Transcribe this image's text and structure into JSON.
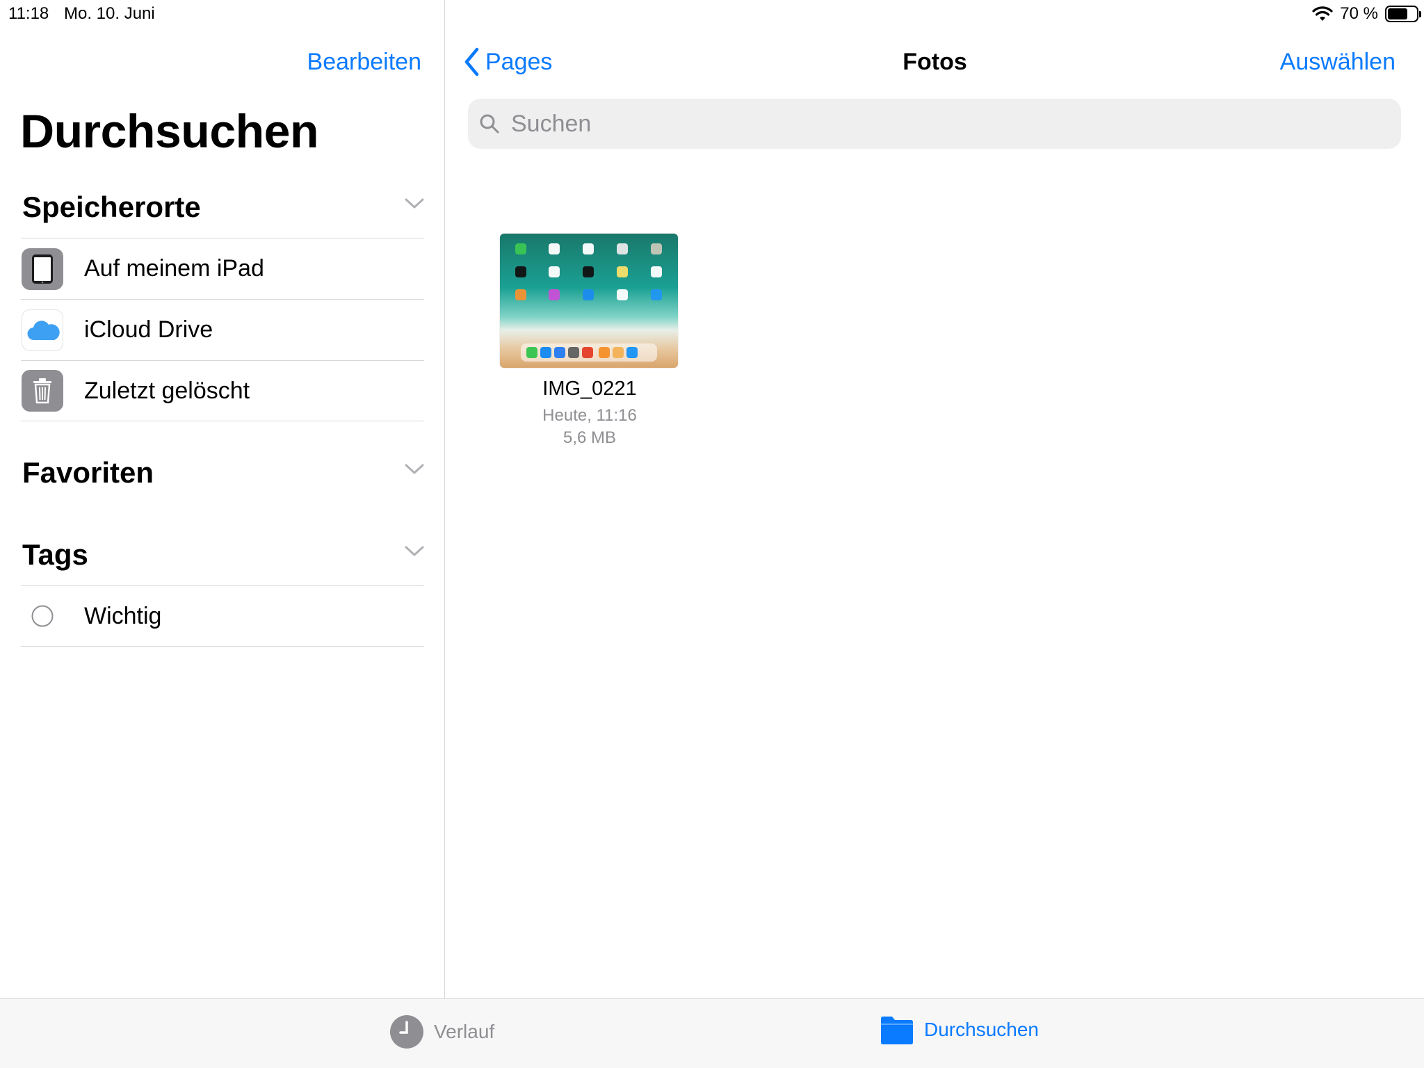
{
  "status_bar": {
    "time": "11:18",
    "date": "Mo. 10. Juni",
    "battery_percent": "70 %",
    "battery_level": 0.7
  },
  "sidebar": {
    "edit_label": "Bearbeiten",
    "title": "Durchsuchen",
    "locations": {
      "title": "Speicherorte",
      "items": [
        {
          "label": "Auf meinem iPad",
          "icon": "ipad-icon"
        },
        {
          "label": "iCloud Drive",
          "icon": "icloud-icon"
        },
        {
          "label": "Zuletzt gelöscht",
          "icon": "trash-icon"
        }
      ]
    },
    "favorites": {
      "title": "Favoriten"
    },
    "tags": {
      "title": "Tags",
      "items": [
        {
          "label": "Wichtig",
          "icon": "tag-circle-icon"
        }
      ]
    }
  },
  "main": {
    "back_label": "Pages",
    "title": "Fotos",
    "select_label": "Auswählen",
    "search_placeholder": "Suchen",
    "files": [
      {
        "name": "IMG_0221",
        "date": "Heute, 11:16",
        "size": "5,6 MB"
      }
    ]
  },
  "tab_bar": {
    "tabs": [
      {
        "label": "Verlauf",
        "icon": "clock-icon",
        "active": false
      },
      {
        "label": "Durchsuchen",
        "icon": "folder-icon",
        "active": true
      }
    ]
  },
  "colors": {
    "accent": "#0a7aff",
    "secondary_text": "#8e8e93",
    "separator": "#d8d8dc"
  }
}
